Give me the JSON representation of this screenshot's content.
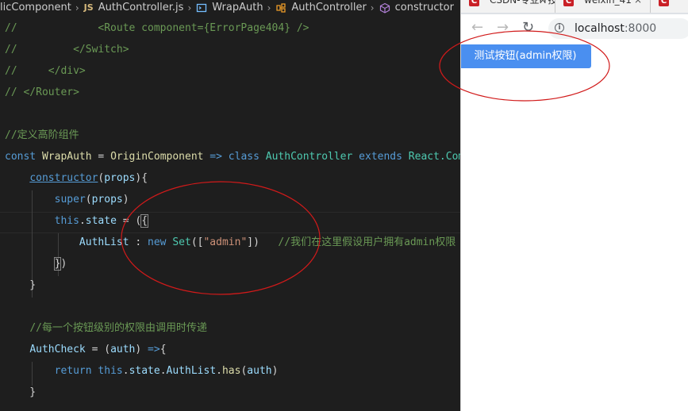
{
  "editor": {
    "breadcrumb": {
      "items": [
        "licComponent",
        "AuthController.js",
        "WrapAuth",
        "AuthController",
        "constructor"
      ],
      "js_badge": "JS"
    },
    "code_lines": [
      [
        {
          "t": "//             <Route component={ErrorPage404} />",
          "c": "comment"
        }
      ],
      [
        {
          "t": "//         </Switch>",
          "c": "comment"
        }
      ],
      [
        {
          "t": "//     </div>",
          "c": "comment"
        }
      ],
      [
        {
          "t": "// </Router>",
          "c": "comment"
        }
      ],
      [],
      [
        {
          "t": "//定义高阶组件",
          "c": "comment"
        }
      ],
      [
        {
          "t": "const ",
          "c": "kw"
        },
        {
          "t": "WrapAuth",
          "c": "fn"
        },
        {
          "t": " = ",
          "c": "punc"
        },
        {
          "t": "OriginComponent",
          "c": "fn"
        },
        {
          "t": " => ",
          "c": "kw"
        },
        {
          "t": "class ",
          "c": "kw"
        },
        {
          "t": "AuthController",
          "c": "cls"
        },
        {
          "t": " extends ",
          "c": "kw"
        },
        {
          "t": "React.Component {",
          "c": "cls"
        }
      ],
      [
        {
          "t": "    ",
          "c": "punc"
        },
        {
          "t": "constructor",
          "c": "kw",
          "u": true
        },
        {
          "t": "(",
          "c": "punc"
        },
        {
          "t": "props",
          "c": "var"
        },
        {
          "t": "){",
          "c": "punc"
        }
      ],
      [
        {
          "t": "        ",
          "c": "punc"
        },
        {
          "t": "super",
          "c": "kw"
        },
        {
          "t": "(",
          "c": "punc"
        },
        {
          "t": "props",
          "c": "var"
        },
        {
          "t": ")",
          "c": "punc"
        }
      ],
      [
        {
          "t": "        ",
          "c": "punc"
        },
        {
          "t": "this",
          "c": "kw"
        },
        {
          "t": ".",
          "c": "punc"
        },
        {
          "t": "state",
          "c": "var"
        },
        {
          "t": " = (",
          "c": "punc"
        },
        {
          "t": "{",
          "c": "punc",
          "box": true
        }
      ],
      [
        {
          "t": "            ",
          "c": "punc"
        },
        {
          "t": "AuthList",
          "c": "var"
        },
        {
          "t": " : ",
          "c": "punc"
        },
        {
          "t": "new ",
          "c": "kw"
        },
        {
          "t": "Set",
          "c": "cls"
        },
        {
          "t": "([",
          "c": "punc"
        },
        {
          "t": "\"admin\"",
          "c": "str"
        },
        {
          "t": "])   ",
          "c": "punc"
        },
        {
          "t": "//我们在这里假设用户拥有admin权限",
          "c": "comment"
        }
      ],
      [
        {
          "t": "        ",
          "c": "punc"
        },
        {
          "t": "}",
          "c": "punc",
          "box": true
        },
        {
          "t": ")",
          "c": "punc"
        }
      ],
      [
        {
          "t": "    }",
          "c": "punc"
        }
      ],
      [],
      [
        {
          "t": "    ",
          "c": "punc"
        },
        {
          "t": "//每一个按钮级别的权限由调用时传递",
          "c": "comment"
        }
      ],
      [
        {
          "t": "    ",
          "c": "punc"
        },
        {
          "t": "AuthCheck",
          "c": "var"
        },
        {
          "t": " = (",
          "c": "punc"
        },
        {
          "t": "auth",
          "c": "var"
        },
        {
          "t": ") ",
          "c": "punc"
        },
        {
          "t": "=>",
          "c": "kw"
        },
        {
          "t": "{",
          "c": "punc"
        }
      ],
      [
        {
          "t": "        ",
          "c": "punc"
        },
        {
          "t": "return ",
          "c": "kw"
        },
        {
          "t": "this",
          "c": "kw"
        },
        {
          "t": ".",
          "c": "punc"
        },
        {
          "t": "state",
          "c": "var"
        },
        {
          "t": ".",
          "c": "punc"
        },
        {
          "t": "AuthList",
          "c": "var"
        },
        {
          "t": ".",
          "c": "punc"
        },
        {
          "t": "has",
          "c": "fn"
        },
        {
          "t": "(",
          "c": "punc"
        },
        {
          "t": "auth",
          "c": "var"
        },
        {
          "t": ")",
          "c": "punc"
        }
      ],
      [
        {
          "t": "    }",
          "c": "punc"
        }
      ]
    ]
  },
  "browser": {
    "tabs": [
      {
        "title": "CSDN-专业IT技术社区"
      },
      {
        "title": "weixin_41"
      },
      {
        "title": ""
      }
    ],
    "close_glyph": "×",
    "nav": {
      "back": "←",
      "forward": "→",
      "reload": "↻"
    },
    "url": {
      "host": "localhost",
      "port": ":8000"
    },
    "test_button": "测试按钮(admin权限)"
  },
  "colors": {
    "editor_bg": "#1e1e1e",
    "comment": "#6a9955",
    "keyword": "#569cd6",
    "function": "#dcdcaa",
    "variable": "#9cdcfe",
    "class": "#4ec9b0",
    "string": "#ce9178",
    "button_bg": "#4a8ff0",
    "annotation_red": "#d11a1a"
  },
  "icons": [
    "chevron-right-icon",
    "js-file-icon",
    "cube-symbol-icon",
    "class-symbol-icon",
    "method-symbol-icon",
    "back-arrow-icon",
    "forward-arrow-icon",
    "reload-icon",
    "info-icon",
    "tab-favicon",
    "close-icon"
  ]
}
